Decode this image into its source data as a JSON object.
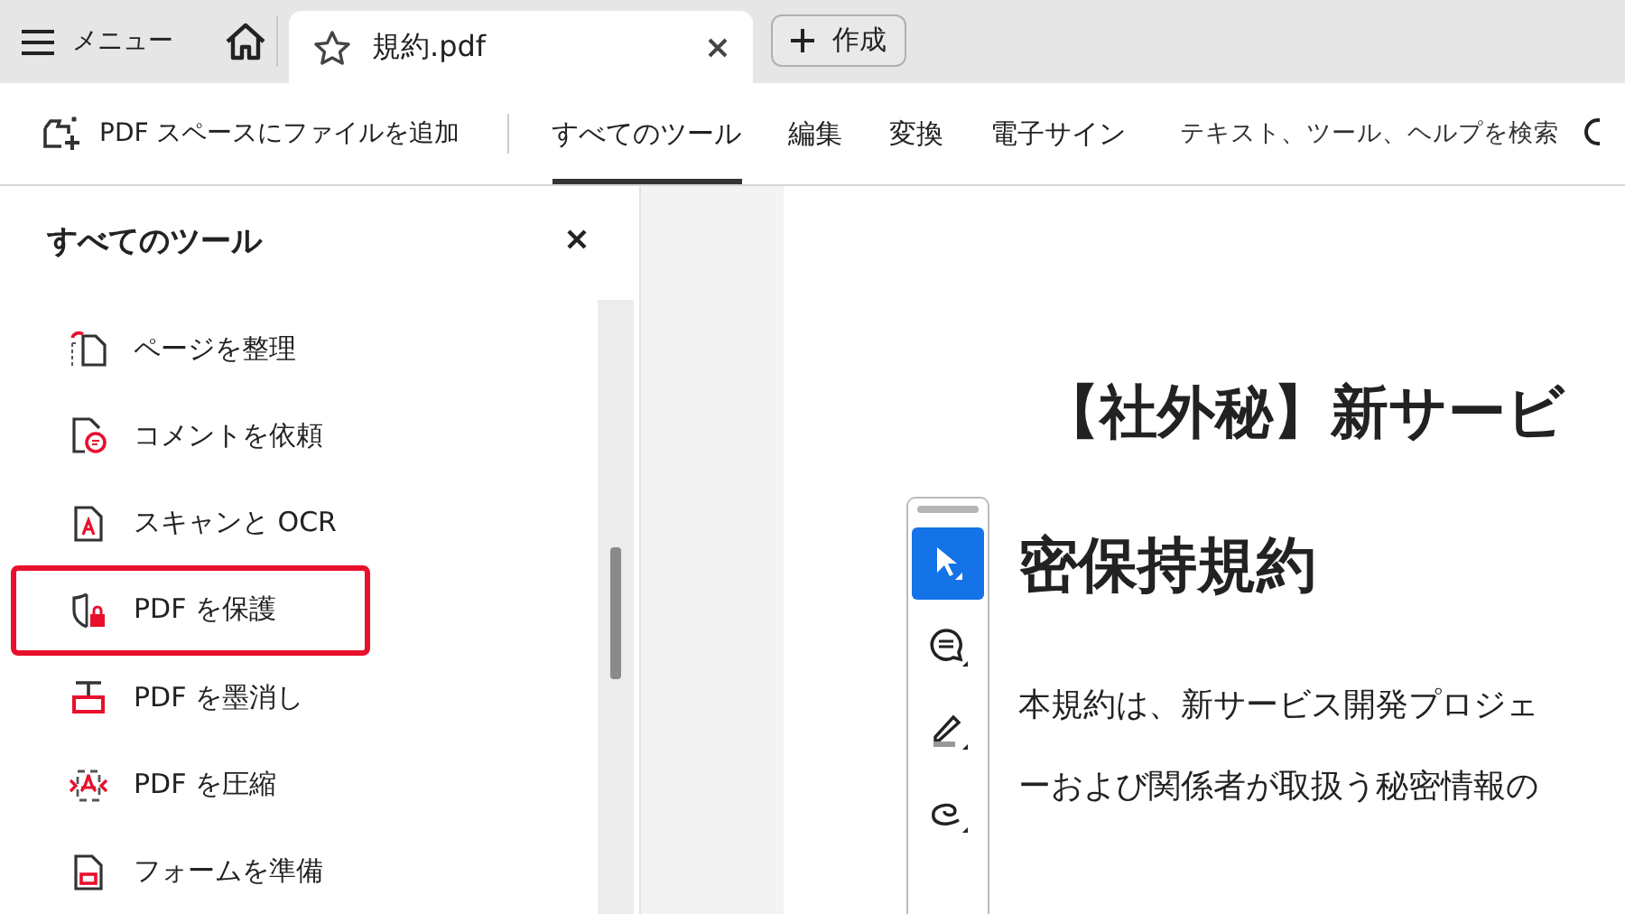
{
  "tab_bar": {
    "menu": "メニュー",
    "tabs": [
      {
        "label": "規約.pdf",
        "selected": true
      }
    ],
    "create": "作成"
  },
  "toolbar": {
    "add_to_space": "PDF スペースにファイルを追加",
    "nav": [
      {
        "label": "すべてのツール",
        "selected": true
      },
      {
        "label": "編集",
        "selected": false
      },
      {
        "label": "変換",
        "selected": false
      },
      {
        "label": "電子サイン",
        "selected": false
      }
    ],
    "search": {
      "placeholder": "テキスト、ツール、ヘルプを検索"
    }
  },
  "sidebar": {
    "title": "すべてのツール",
    "items": [
      {
        "label": "ページを整理",
        "highlighted": false
      },
      {
        "label": "コメントを依頼",
        "highlighted": false
      },
      {
        "label": "スキャンと OCR",
        "highlighted": false
      },
      {
        "label": "PDF を保護",
        "highlighted": true
      },
      {
        "label": "PDF を墨消し",
        "highlighted": false
      },
      {
        "label": "PDF を圧縮",
        "highlighted": false
      },
      {
        "label": "フォームを準備",
        "highlighted": false
      }
    ]
  },
  "quick_tools": [
    {
      "kind": "select",
      "selected": true
    },
    {
      "kind": "comment",
      "selected": false
    },
    {
      "kind": "highlight",
      "selected": false
    },
    {
      "kind": "draw",
      "selected": false
    }
  ],
  "document": {
    "title": "【社外秘】新サービ",
    "heading": "密保持規約",
    "paragraph_lines": [
      "本規約は、新サービス開発プロジェ",
      "ーおよび関係者が取扱う秘密情報の"
    ]
  }
}
